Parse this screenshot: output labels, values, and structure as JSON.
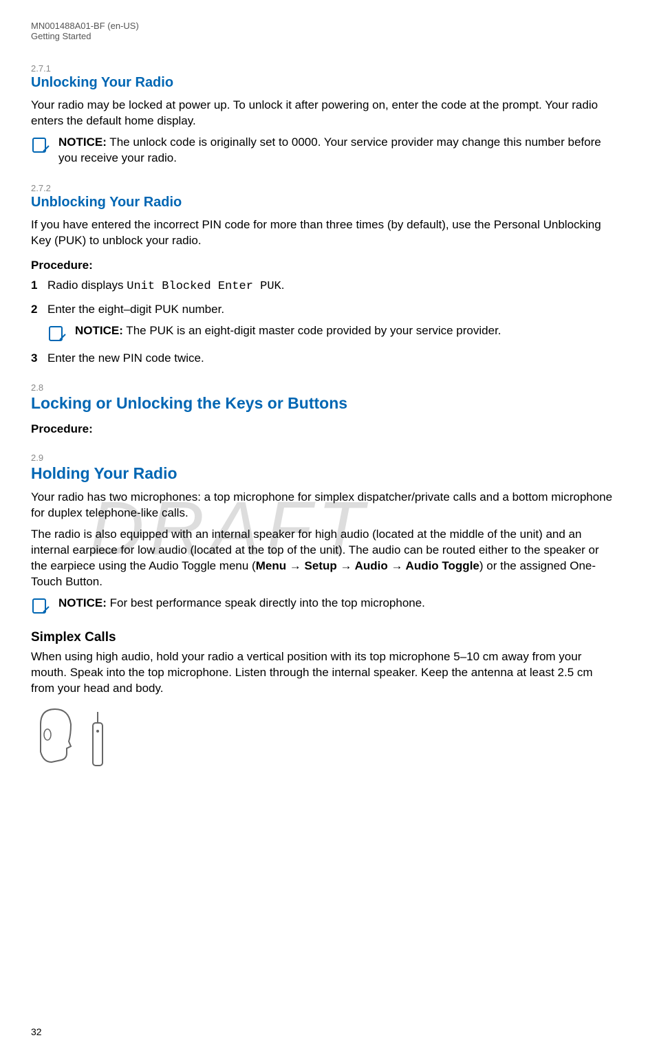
{
  "header": {
    "doc_id": "MN001488A01-BF (en-US)",
    "chapter": "Getting Started"
  },
  "watermark": "DRAFT",
  "sections": {
    "s271": {
      "num": "2.7.1",
      "title": "Unlocking Your Radio",
      "para": "Your radio may be locked at power up. To unlock it after powering on, enter the code at the prompt. Your radio enters the default home display.",
      "notice_label": "NOTICE:",
      "notice": " The unlock code is originally set to 0000. Your service provider may change this number before you receive your radio."
    },
    "s272": {
      "num": "2.7.2",
      "title": "Unblocking Your Radio",
      "para": "If you have entered the incorrect PIN code for more than three times (by default), use the Personal Unblocking Key (PUK) to unblock your radio.",
      "procedure_label": "Procedure:",
      "step1_prefix": "Radio displays ",
      "step1_code": "Unit Blocked Enter PUK",
      "step1_suffix": ".",
      "step2": "Enter the eight–digit PUK number.",
      "step2_notice_label": "NOTICE:",
      "step2_notice": " The PUK is an eight-digit master code provided by your service provider.",
      "step3": "Enter the new PIN code twice."
    },
    "s28": {
      "num": "2.8",
      "title": "Locking or Unlocking the Keys or Buttons",
      "procedure_label": "Procedure:"
    },
    "s29": {
      "num": "2.9",
      "title": "Holding Your Radio",
      "para1": "Your radio has two microphones: a top microphone for simplex dispatcher/private calls and a bottom microphone for duplex telephone-like calls.",
      "para2_prefix": "The radio is also equipped with an internal speaker for high audio (located at the middle of the unit) and an internal earpiece for low audio (located at the top of the unit). The audio can be routed either to the speaker or the earpiece using the Audio Toggle menu (",
      "para2_menu": "Menu → Setup → Audio → Audio Toggle",
      "para2_suffix": ") or the assigned One-Touch Button.",
      "notice_label": "NOTICE:",
      "notice": " For best performance speak directly into the top microphone.",
      "sub_heading": "Simplex Calls",
      "sub_para": "When using high audio, hold your radio a vertical position with its top microphone 5–10 cm away from your mouth. Speak into the top microphone. Listen through the internal speaker. Keep the antenna at least 2.5 cm from your head and body."
    }
  },
  "page": "32"
}
